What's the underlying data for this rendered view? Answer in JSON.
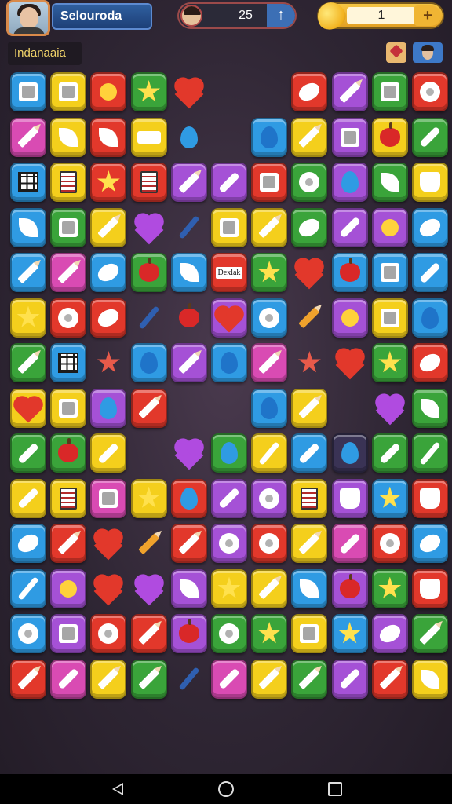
{
  "header": {
    "player_name": "Selouroda",
    "moves": "25",
    "moves_plus": "↑",
    "coins": "1",
    "coins_plus": "+",
    "level_name": "Indanaaia"
  },
  "tile_label": "Dexlak",
  "colors": {
    "blue": "#2f9be3",
    "yellow": "#f4cf1c",
    "red": "#e2382b",
    "green": "#3aa43a",
    "purple": "#a551d6",
    "magenta": "#d94bb3",
    "orange": "#f08a24",
    "dark": "#3a3355"
  },
  "board": {
    "rows": [
      [
        "blue:box",
        "yellow:box",
        "red:sun",
        "green:star",
        "loose:heart",
        "",
        "",
        "red:oval",
        "purple:pencil",
        "green:box",
        "red:gear"
      ],
      [
        "magenta:pencil",
        "yellow:leaf",
        "red:leaf",
        "yellow:tag",
        "loose:drop",
        "",
        "blue:drop",
        "yellow:pencil",
        "purple:box",
        "yellow:apple",
        "green:bar"
      ],
      [
        "blue:grid",
        "yellow:doc",
        "red:star",
        "red:doc",
        "purple:pencil",
        "purple:bar",
        "red:box",
        "green:gear",
        "purple:drop",
        "green:leaf",
        "yellow:cup"
      ],
      [
        "blue:leaf",
        "green:box",
        "yellow:pencil",
        "loose:heart",
        "loose:knife",
        "yellow:box",
        "yellow:pencil",
        "green:oval",
        "purple:bar",
        "purple:sun",
        "blue:oval"
      ],
      [
        "blue:pencil",
        "magenta:pencil",
        "blue:oval",
        "green:apple",
        "blue:leaf",
        "red:label",
        "green:star",
        "loose:heart",
        "blue:apple",
        "blue:box",
        "blue:bar"
      ],
      [
        "yellow:star",
        "red:gear",
        "red:oval",
        "loose:knife",
        "loose:apple",
        "purple:heart",
        "blue:gear",
        "loose:pencil",
        "purple:sun",
        "yellow:box",
        "blue:drop"
      ],
      [
        "green:pencil",
        "blue:grid",
        "loose:star",
        "blue:drop",
        "purple:pencil",
        "blue:drop",
        "magenta:pencil",
        "loose:star",
        "loose:heart",
        "green:star",
        "red:oval"
      ],
      [
        "yellow:heart",
        "yellow:box",
        "purple:drop",
        "red:pencil",
        "",
        "",
        "blue:drop",
        "yellow:pencil",
        "",
        "loose:heart",
        "green:leaf"
      ],
      [
        "green:bar",
        "green:apple",
        "yellow:bar",
        "",
        "loose:heart",
        "green:drop",
        "yellow:knife",
        "blue:bar",
        "dark:drop",
        "green:bar",
        "green:knife"
      ],
      [
        "yellow:bar",
        "yellow:doc",
        "magenta:box",
        "yellow:star",
        "red:drop",
        "purple:bar",
        "purple:gear",
        "yellow:doc",
        "purple:cup",
        "blue:star",
        "red:cup"
      ],
      [
        "blue:oval",
        "red:pencil",
        "loose:heart",
        "loose:pencil",
        "red:pencil",
        "purple:gear",
        "red:gear",
        "yellow:pencil",
        "magenta:bar",
        "red:gear",
        "blue:oval"
      ],
      [
        "blue:knife",
        "purple:sun",
        "loose:heart",
        "loose:heart",
        "purple:leaf",
        "yellow:star",
        "yellow:pencil",
        "blue:leaf",
        "purple:apple",
        "green:star",
        "red:cup"
      ],
      [
        "blue:gear",
        "purple:box",
        "red:gear",
        "red:pencil",
        "purple:apple",
        "green:gear",
        "green:star",
        "yellow:box",
        "blue:star",
        "purple:oval",
        "green:pencil"
      ],
      [
        "red:pencil",
        "magenta:bar",
        "yellow:pencil",
        "green:pencil",
        "loose:knife",
        "magenta:bar",
        "yellow:pencil",
        "green:pencil",
        "purple:bar",
        "red:pencil",
        "yellow:leaf"
      ]
    ]
  }
}
